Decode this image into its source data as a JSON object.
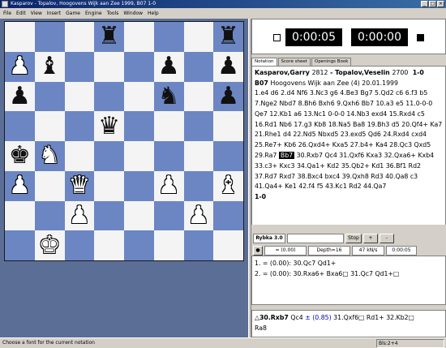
{
  "window": {
    "title": "Kasparov - Topalov, Hoogovens Wijk aan Zee 1999, B07 1-0"
  },
  "menu": [
    "File",
    "Edit",
    "View",
    "Insert",
    "Game",
    "Engine",
    "Tools",
    "Window",
    "Help"
  ],
  "board": {
    "rows": [
      [
        "",
        "",
        "",
        "bR",
        "",
        "",
        "",
        "bR"
      ],
      [
        "wP",
        "bB",
        "",
        "",
        "",
        "bP",
        "",
        "bP"
      ],
      [
        "bP",
        "",
        "",
        "",
        "",
        "bN",
        "",
        "bP"
      ],
      [
        "",
        "",
        "",
        "bQ",
        "",
        "",
        "",
        ""
      ],
      [
        "bK",
        "wN",
        "",
        "",
        "",
        "",
        "",
        ""
      ],
      [
        "wP",
        "",
        "wQ",
        "",
        "",
        "wP",
        "",
        "wB"
      ],
      [
        "",
        "",
        "wP",
        "",
        "",
        "",
        "wP",
        ""
      ],
      [
        "",
        "wK",
        "",
        "",
        "",
        "",
        "",
        ""
      ]
    ],
    "light_color": "#f4f4f4",
    "dark_color": "#6c86c4"
  },
  "clocks": {
    "white": "0:00:05",
    "black": "0:00:00"
  },
  "tabs": [
    "Notation",
    "Score sheet",
    "Openings Book"
  ],
  "game": {
    "white": "Kasparov,Garry",
    "white_elo": "2812",
    "black": "Topalov,Veselin",
    "black_elo": "2700",
    "result": "1-0",
    "eco": "B07",
    "event": "Hoogovens Wijk aan Zee (4) 20.01.1999",
    "moves_before": "1.e4 d6 2.d4 Nf6 3.Nc3 g6 4.Be3 Bg7 5.Qd2 c6 6.f3 b5 7.Nge2 Nbd7 8.Bh6 Bxh6 9.Qxh6 Bb7 10.a3 e5 11.0-0-0 Qe7 12.Kb1 a6 13.Nc1 0-0-0 14.Nb3 exd4 15.Rxd4 c5 16.Rd1 Nb6 17.g3 Kb8 18.Na5 Ba8 19.Bh3 d5 20.Qf4+ Ka7 21.Rhe1 d4 22.Nd5 Nbxd5 23.exd5 Qd6 24.Rxd4 cxd4 25.Re7+ Kb6 26.Qxd4+ Kxa5 27.b4+ Ka4 28.Qc3 Qxd5 29.Ra7",
    "current_move": "Bb7",
    "moves_after": "30.Rxb7 Qc4 31.Qxf6 Kxa3 32.Qxa6+ Kxb4 33.c3+ Kxc3 34.Qa1+ Kd2 35.Qb2+ Kd1 36.Bf1 Rd2 37.Rd7 Rxd7 38.Bxc4 bxc4 39.Qxh8 Rd3 40.Qa8 c3 41.Qa4+ Ke1 42.f4 f5 43.Kc1 Rd2 44.Qa7",
    "final": "1-0"
  },
  "engine": {
    "name": "Rybka 3.0",
    "stop_label": "Stop",
    "plus_icon": "+",
    "minus_icon": "-",
    "eval": "= (0.00)",
    "depth": "Depth=16",
    "speed": "47 kN/s",
    "time": "0:00:05",
    "lines": [
      "1. = (0.00): 30.Qc7 Qd1+",
      "2. = (0.00): 30.Rxa6+ Bxa6□ 31.Qc7 Qd1+□"
    ]
  },
  "comment": {
    "move": "△30.Rxb7",
    "text1": "Qc4",
    "eval": "± (0.85)",
    "text2": "31.Qxf6□ Rd1+ 32.Kb2□",
    "text3": "Ra8"
  },
  "status": {
    "left": "Choose a font for the current notation",
    "right": "Bls:2+4"
  }
}
